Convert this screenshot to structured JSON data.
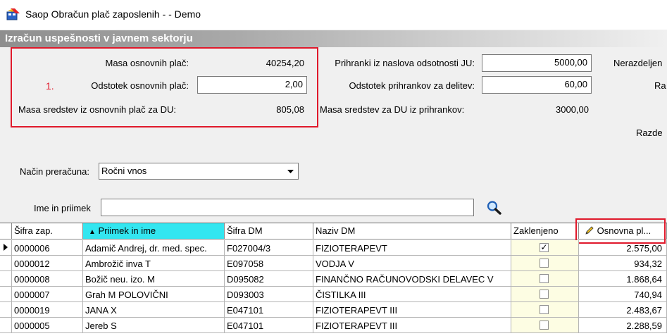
{
  "window": {
    "title": "Saop Obračun plač zaposlenih -  - Demo"
  },
  "section": {
    "title": "Izračun uspešnosti v javnem sektorju"
  },
  "left_panel": {
    "masa_label": "Masa osnovnih plač:",
    "masa_value": "40254,20",
    "marker": "1.",
    "odstotek_label": "Odstotek osnovnih plač:",
    "odstotek_value": "2,00",
    "sredstva_label": "Masa sredstev iz osnovnih plač za DU:",
    "sredstva_value": "805,08"
  },
  "middle_panel": {
    "prihranki_label": "Prihranki iz naslova odsotnosti JU:",
    "prihranki_value": "5000,00",
    "odstotek_label": "Odstotek prihrankov za delitev:",
    "odstotek_value": "60,00",
    "masa_label": "Masa sredstev za DU iz prihrankov:",
    "masa_value": "3000,00"
  },
  "right_panel": {
    "nerazdeljeno_label": "Nerazdeljen",
    "ra_label": "Ra",
    "razde_label": "Razde"
  },
  "filters": {
    "nacin_label": "Način preračuna:",
    "nacin_value": "Ročni vnos",
    "ime_label": "Ime in priimek",
    "ime_value": ""
  },
  "colors": {
    "accent_red": "#e0192b",
    "sorted_header": "#33e6f0",
    "locked_cell": "#fdfde3"
  },
  "icons": {
    "search": "magnifier-icon",
    "edit": "pencil-icon",
    "sort": "sort-ascending-icon",
    "row_pointer": "row-pointer-icon"
  },
  "grid": {
    "columns": [
      "Šifra zap.",
      "Priimek in ime",
      "Šifra DM",
      "Naziv DM",
      "Zaklenjeno",
      "Osnovna pl..."
    ],
    "rows": [
      {
        "sifra": "0000006",
        "ime": "Adamič Andrej, dr. med. spec.",
        "sifra_dm": "F027004/3",
        "naziv_dm": "FIZIOTERAPEVT",
        "zaklenjeno": true,
        "osnovna": "2.575,00"
      },
      {
        "sifra": "0000012",
        "ime": "Ambrožič inva T",
        "sifra_dm": "E097058",
        "naziv_dm": "VODJA V",
        "zaklenjeno": false,
        "osnovna": "934,32"
      },
      {
        "sifra": "0000008",
        "ime": "Božič neu. izo. M",
        "sifra_dm": "D095082",
        "naziv_dm": "FINANČNO RAČUNOVODSKI DELAVEC V",
        "zaklenjeno": false,
        "osnovna": "1.868,64"
      },
      {
        "sifra": "0000007",
        "ime": "Grah M POLOVIČNI",
        "sifra_dm": "D093003",
        "naziv_dm": "ČISTILKA III",
        "zaklenjeno": false,
        "osnovna": "740,94"
      },
      {
        "sifra": "0000019",
        "ime": "JANA X",
        "sifra_dm": "E047101",
        "naziv_dm": "FIZIOTERAPEVT III",
        "zaklenjeno": false,
        "osnovna": "2.483,67"
      },
      {
        "sifra": "0000005",
        "ime": "Jereb S",
        "sifra_dm": "E047101",
        "naziv_dm": "FIZIOTERAPEVT III",
        "zaklenjeno": false,
        "osnovna": "2.288,59"
      }
    ]
  }
}
